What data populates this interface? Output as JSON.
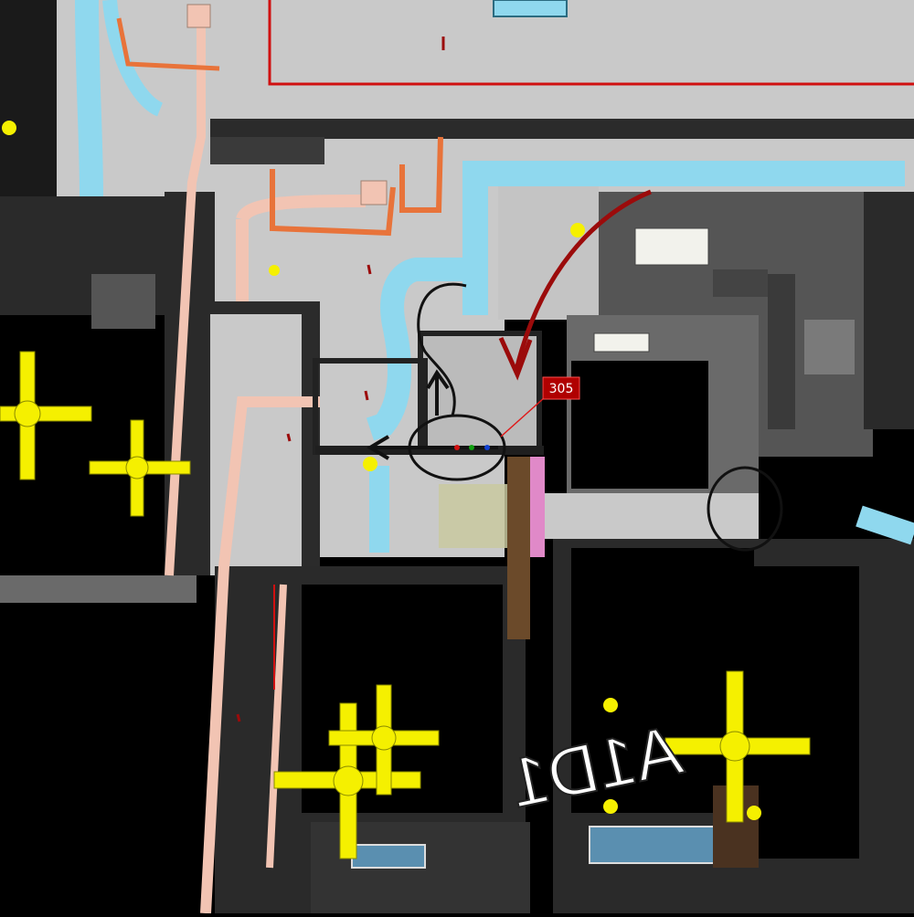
{
  "scene": {
    "colors": {
      "floor": "#c9c9c9",
      "wall_dark": "#2b2b2b",
      "wall_mid": "#4a4a4a",
      "void": "#000000",
      "duct_blue": "#8fd8ee",
      "pipe_pink": "#f2c4b3",
      "pipe_orange": "#e8733a",
      "fan_yellow": "#f5f000",
      "markup_red": "#9b0b0b",
      "markup_black": "#111111",
      "tag_red": "#e01818",
      "fixture_white": "#f2f2ec",
      "door_brown": "#6b4a2a",
      "panel_pink": "#e089c8",
      "window_blue": "#5a8fb0"
    },
    "annotation_tag": {
      "text": "305"
    },
    "mirrored_room_label": "A1D1"
  }
}
